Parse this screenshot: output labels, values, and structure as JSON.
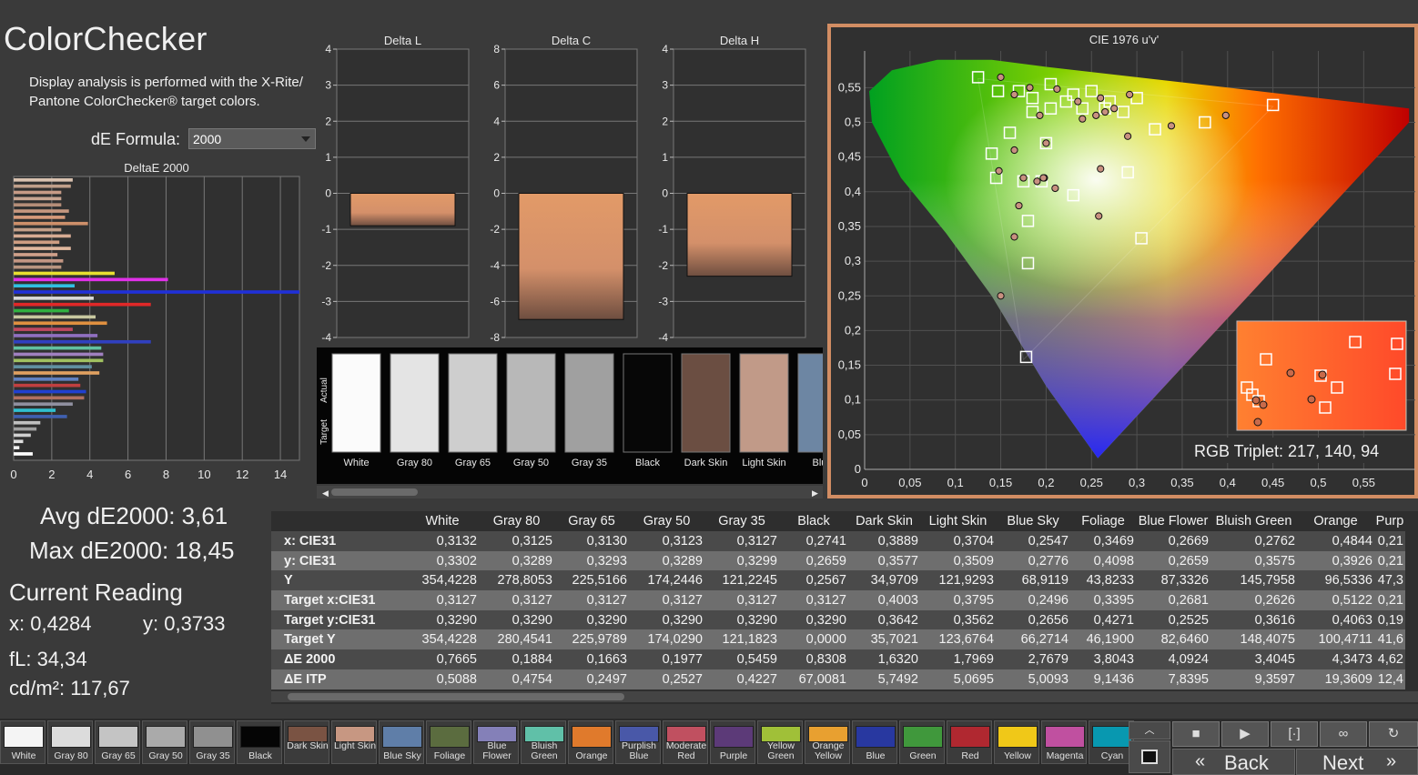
{
  "app": {
    "title": "ColorChecker",
    "intro": "Display analysis is performed with the X-Rite/ Pantone ColorChecker® target colors.",
    "formula_label": "dE Formula:",
    "formula_value": "2000"
  },
  "deltae_chart": {
    "title": "DeltaE 2000",
    "ticks": [
      "0",
      "2",
      "4",
      "6",
      "8",
      "10",
      "12",
      "14"
    ],
    "xlim": [
      0,
      15
    ],
    "bars": [
      {
        "value": 3.1,
        "color": "#d9c2b0"
      },
      {
        "value": 3.0,
        "color": "#bf9f8a"
      },
      {
        "value": 2.5,
        "color": "#c79b86"
      },
      {
        "value": 2.5,
        "color": "#c8a591"
      },
      {
        "value": 2.5,
        "color": "#b48d78"
      },
      {
        "value": 2.9,
        "color": "#c6977f"
      },
      {
        "value": 2.7,
        "color": "#d69a7a"
      },
      {
        "value": 3.9,
        "color": "#cd8f6a"
      },
      {
        "value": 2.5,
        "color": "#c49f88"
      },
      {
        "value": 3.0,
        "color": "#d7ab93"
      },
      {
        "value": 2.4,
        "color": "#cd9d82"
      },
      {
        "value": 3.0,
        "color": "#e0b79e"
      },
      {
        "value": 2.3,
        "color": "#cfa08a"
      },
      {
        "value": 2.6,
        "color": "#c39683"
      },
      {
        "value": 2.5,
        "color": "#b99580"
      },
      {
        "value": 5.3,
        "color": "#e8e030"
      },
      {
        "value": 8.1,
        "color": "#e030e8"
      },
      {
        "value": 3.2,
        "color": "#30c0e0"
      },
      {
        "value": 18.45,
        "color": "#2030d8"
      },
      {
        "value": 4.2,
        "color": "#d8d8d8"
      },
      {
        "value": 7.2,
        "color": "#e02828"
      },
      {
        "value": 2.9,
        "color": "#30b040"
      },
      {
        "value": 4.3,
        "color": "#c8c8a0"
      },
      {
        "value": 4.9,
        "color": "#e09040"
      },
      {
        "value": 3.1,
        "color": "#c04860"
      },
      {
        "value": 4.4,
        "color": "#9070c0"
      },
      {
        "value": 7.2,
        "color": "#3040c0"
      },
      {
        "value": 4.6,
        "color": "#60c0a0"
      },
      {
        "value": 4.7,
        "color": "#a080c0"
      },
      {
        "value": 4.7,
        "color": "#a0c060"
      },
      {
        "value": 4.1,
        "color": "#6090a0"
      },
      {
        "value": 4.5,
        "color": "#e0a060"
      },
      {
        "value": 3.4,
        "color": "#6080c0"
      },
      {
        "value": 3.5,
        "color": "#c04040"
      },
      {
        "value": 3.8,
        "color": "#2040d0"
      },
      {
        "value": 3.7,
        "color": "#b07060"
      },
      {
        "value": 3.1,
        "color": "#9090a0"
      },
      {
        "value": 2.2,
        "color": "#30c0d0"
      },
      {
        "value": 2.8,
        "color": "#4060b0"
      },
      {
        "value": 1.4,
        "color": "#c0c0c0"
      },
      {
        "value": 1.2,
        "color": "#a0a0a0"
      },
      {
        "value": 0.9,
        "color": "#d0d0d0"
      },
      {
        "value": 0.5,
        "color": "#e0e0e0"
      },
      {
        "value": 0.3,
        "color": "#f0f0f0"
      },
      {
        "value": 1.0,
        "color": "#ffffff"
      }
    ]
  },
  "delta_charts": [
    {
      "title": "Delta L",
      "ticks": [
        "4",
        "3",
        "2",
        "1",
        "0",
        "-1",
        "-2",
        "-3",
        "-4"
      ],
      "ylim": [
        -4,
        4
      ],
      "value": -0.9
    },
    {
      "title": "Delta C",
      "ticks": [
        "8",
        "6",
        "4",
        "2",
        "0",
        "-2",
        "-4",
        "-6",
        "-8"
      ],
      "ylim": [
        -8,
        8
      ],
      "value": -7.0
    },
    {
      "title": "Delta H",
      "ticks": [
        "4",
        "3",
        "2",
        "1",
        "0",
        "-1",
        "-2",
        "-3",
        "-4"
      ],
      "ylim": [
        -4,
        4
      ],
      "value": -2.3
    }
  ],
  "swatch_panel": {
    "actual_label": "Actual",
    "target_label": "Target",
    "swatches": [
      {
        "name": "White",
        "color": "#fbfbfb"
      },
      {
        "name": "Gray 80",
        "color": "#e4e4e4"
      },
      {
        "name": "Gray 65",
        "color": "#cecece"
      },
      {
        "name": "Gray 50",
        "color": "#b8b8b8"
      },
      {
        "name": "Gray 35",
        "color": "#a0a0a0"
      },
      {
        "name": "Black",
        "color": "#070707"
      },
      {
        "name": "Dark Skin",
        "color": "#6b4e42"
      },
      {
        "name": "Light Skin",
        "color": "#c19a88"
      },
      {
        "name": "Blue",
        "color": "#6d86a3"
      }
    ]
  },
  "cie": {
    "title": "CIE 1976 u'v'",
    "xticks": [
      "0",
      "0,05",
      "0,1",
      "0,15",
      "0,2",
      "0,25",
      "0,3",
      "0,35",
      "0,4",
      "0,45",
      "0,5",
      "0,55"
    ],
    "yticks": [
      "0,55",
      "0,5",
      "0,45",
      "0,4",
      "0,35",
      "0,3",
      "0,25",
      "0,2",
      "0,15",
      "0,1",
      "0,05",
      "0"
    ],
    "rgb_triplet": "RGB Triplet: 217, 140, 94",
    "targets": [
      [
        0.125,
        0.565
      ],
      [
        0.147,
        0.545
      ],
      [
        0.17,
        0.545
      ],
      [
        0.185,
        0.535
      ],
      [
        0.205,
        0.555
      ],
      [
        0.23,
        0.54
      ],
      [
        0.24,
        0.52
      ],
      [
        0.27,
        0.53
      ],
      [
        0.3,
        0.535
      ],
      [
        0.205,
        0.52
      ],
      [
        0.222,
        0.53
      ],
      [
        0.25,
        0.545
      ],
      [
        0.32,
        0.49
      ],
      [
        0.375,
        0.5
      ],
      [
        0.45,
        0.525
      ],
      [
        0.185,
        0.515
      ],
      [
        0.16,
        0.485
      ],
      [
        0.14,
        0.455
      ],
      [
        0.145,
        0.42
      ],
      [
        0.175,
        0.415
      ],
      [
        0.195,
        0.415
      ],
      [
        0.2,
        0.47
      ],
      [
        0.23,
        0.395
      ],
      [
        0.29,
        0.428
      ],
      [
        0.18,
        0.358
      ],
      [
        0.305,
        0.333
      ],
      [
        0.18,
        0.297
      ],
      [
        0.178,
        0.162
      ],
      [
        0.265,
        0.52
      ],
      [
        0.285,
        0.515
      ]
    ],
    "measured": [
      [
        0.15,
        0.565
      ],
      [
        0.165,
        0.54
      ],
      [
        0.182,
        0.55
      ],
      [
        0.212,
        0.548
      ],
      [
        0.235,
        0.53
      ],
      [
        0.26,
        0.535
      ],
      [
        0.292,
        0.54
      ],
      [
        0.193,
        0.51
      ],
      [
        0.24,
        0.505
      ],
      [
        0.255,
        0.51
      ],
      [
        0.265,
        0.515
      ],
      [
        0.275,
        0.52
      ],
      [
        0.338,
        0.495
      ],
      [
        0.398,
        0.51
      ],
      [
        0.165,
        0.46
      ],
      [
        0.148,
        0.43
      ],
      [
        0.175,
        0.42
      ],
      [
        0.19,
        0.415
      ],
      [
        0.21,
        0.405
      ],
      [
        0.26,
        0.433
      ],
      [
        0.29,
        0.48
      ],
      [
        0.2,
        0.47
      ],
      [
        0.198,
        0.42
      ],
      [
        0.17,
        0.38
      ],
      [
        0.258,
        0.365
      ],
      [
        0.165,
        0.335
      ],
      [
        0.15,
        0.25
      ],
      [
        0.197,
        0.42
      ]
    ]
  },
  "stats": {
    "avg": "Avg dE2000: 3,61",
    "max": "Max dE2000: 18,45",
    "current_reading": "Current Reading",
    "x": "x: 0,4284",
    "y": "y: 0,3733",
    "fl": "fL: 34,34",
    "cdm2": "cd/m²: 117,67"
  },
  "table": {
    "columns": [
      "White",
      "Gray 80",
      "Gray 65",
      "Gray 50",
      "Gray 35",
      "Black",
      "Dark Skin",
      "Light Skin",
      "Blue Sky",
      "Foliage",
      "Blue Flower",
      "Bluish Green",
      "Orange",
      "Purp"
    ],
    "rows": [
      {
        "label": "x: CIE31",
        "values": [
          "0,3132",
          "0,3125",
          "0,3130",
          "0,3123",
          "0,3127",
          "0,2741",
          "0,3889",
          "0,3704",
          "0,2547",
          "0,3469",
          "0,2669",
          "0,2762",
          "0,4844",
          "0,21"
        ]
      },
      {
        "label": "y: CIE31",
        "values": [
          "0,3302",
          "0,3289",
          "0,3293",
          "0,3289",
          "0,3299",
          "0,2659",
          "0,3577",
          "0,3509",
          "0,2776",
          "0,4098",
          "0,2659",
          "0,3575",
          "0,3926",
          "0,21"
        ]
      },
      {
        "label": "Y",
        "values": [
          "354,4228",
          "278,8053",
          "225,5166",
          "174,2446",
          "121,2245",
          "0,2567",
          "34,9709",
          "121,9293",
          "68,9119",
          "43,8233",
          "87,3326",
          "145,7958",
          "96,5336",
          "47,3"
        ]
      },
      {
        "label": "Target x:CIE31",
        "values": [
          "0,3127",
          "0,3127",
          "0,3127",
          "0,3127",
          "0,3127",
          "0,3127",
          "0,4003",
          "0,3795",
          "0,2496",
          "0,3395",
          "0,2681",
          "0,2626",
          "0,5122",
          "0,21"
        ]
      },
      {
        "label": "Target y:CIE31",
        "values": [
          "0,3290",
          "0,3290",
          "0,3290",
          "0,3290",
          "0,3290",
          "0,3290",
          "0,3642",
          "0,3562",
          "0,2656",
          "0,4271",
          "0,2525",
          "0,3616",
          "0,4063",
          "0,19"
        ]
      },
      {
        "label": "Target Y",
        "values": [
          "354,4228",
          "280,4541",
          "225,9789",
          "174,0290",
          "121,1823",
          "0,0000",
          "35,7021",
          "123,6764",
          "66,2714",
          "46,1900",
          "82,6460",
          "148,4075",
          "100,4711",
          "41,6"
        ]
      },
      {
        "label": "ΔE 2000",
        "values": [
          "0,7665",
          "0,1884",
          "0,1663",
          "0,1977",
          "0,5459",
          "0,8308",
          "1,6320",
          "1,7969",
          "2,7679",
          "3,8043",
          "4,0924",
          "3,4045",
          "4,3473",
          "4,62"
        ]
      },
      {
        "label": "ΔE ITP",
        "values": [
          "0,5088",
          "0,4754",
          "0,2497",
          "0,2527",
          "0,4227",
          "67,0081",
          "5,7492",
          "5,0695",
          "5,0093",
          "9,1436",
          "7,8395",
          "9,3597",
          "19,3609",
          "12,4"
        ]
      }
    ]
  },
  "bottom_swatches": [
    {
      "label": "White",
      "color": "#f4f4f4"
    },
    {
      "label": "Gray 80",
      "color": "#dcdcdc"
    },
    {
      "label": "Gray 65",
      "color": "#c4c4c4"
    },
    {
      "label": "Gray 50",
      "color": "#aaaaaa"
    },
    {
      "label": "Gray 35",
      "color": "#909090"
    },
    {
      "label": "Black",
      "color": "#050505"
    },
    {
      "label": "Dark Skin",
      "color": "#7a5343"
    },
    {
      "label": "Light Skin",
      "color": "#c79782"
    },
    {
      "label": "Blue Sky",
      "color": "#5f7ea8"
    },
    {
      "label": "Foliage",
      "color": "#5b6c3f"
    },
    {
      "label": "Blue Flower",
      "color": "#8480b8"
    },
    {
      "label": "Bluish Green",
      "color": "#60c0a8"
    },
    {
      "label": "Orange",
      "color": "#e07a2c"
    },
    {
      "label": "Purplish Blue",
      "color": "#4958a8"
    },
    {
      "label": "Moderate Red",
      "color": "#c05060"
    },
    {
      "label": "Purple",
      "color": "#5c3a78"
    },
    {
      "label": "Yellow Green",
      "color": "#a0c038"
    },
    {
      "label": "Orange Yellow",
      "color": "#e8a030"
    },
    {
      "label": "Blue",
      "color": "#2838a0"
    },
    {
      "label": "Green",
      "color": "#40983c"
    },
    {
      "label": "Red",
      "color": "#b02830"
    },
    {
      "label": "Yellow",
      "color": "#f0c818"
    },
    {
      "label": "Magenta",
      "color": "#c050a0"
    },
    {
      "label": "Cyan",
      "color": "#0898b0"
    }
  ],
  "nav": {
    "back": "Back",
    "next": "Next"
  }
}
